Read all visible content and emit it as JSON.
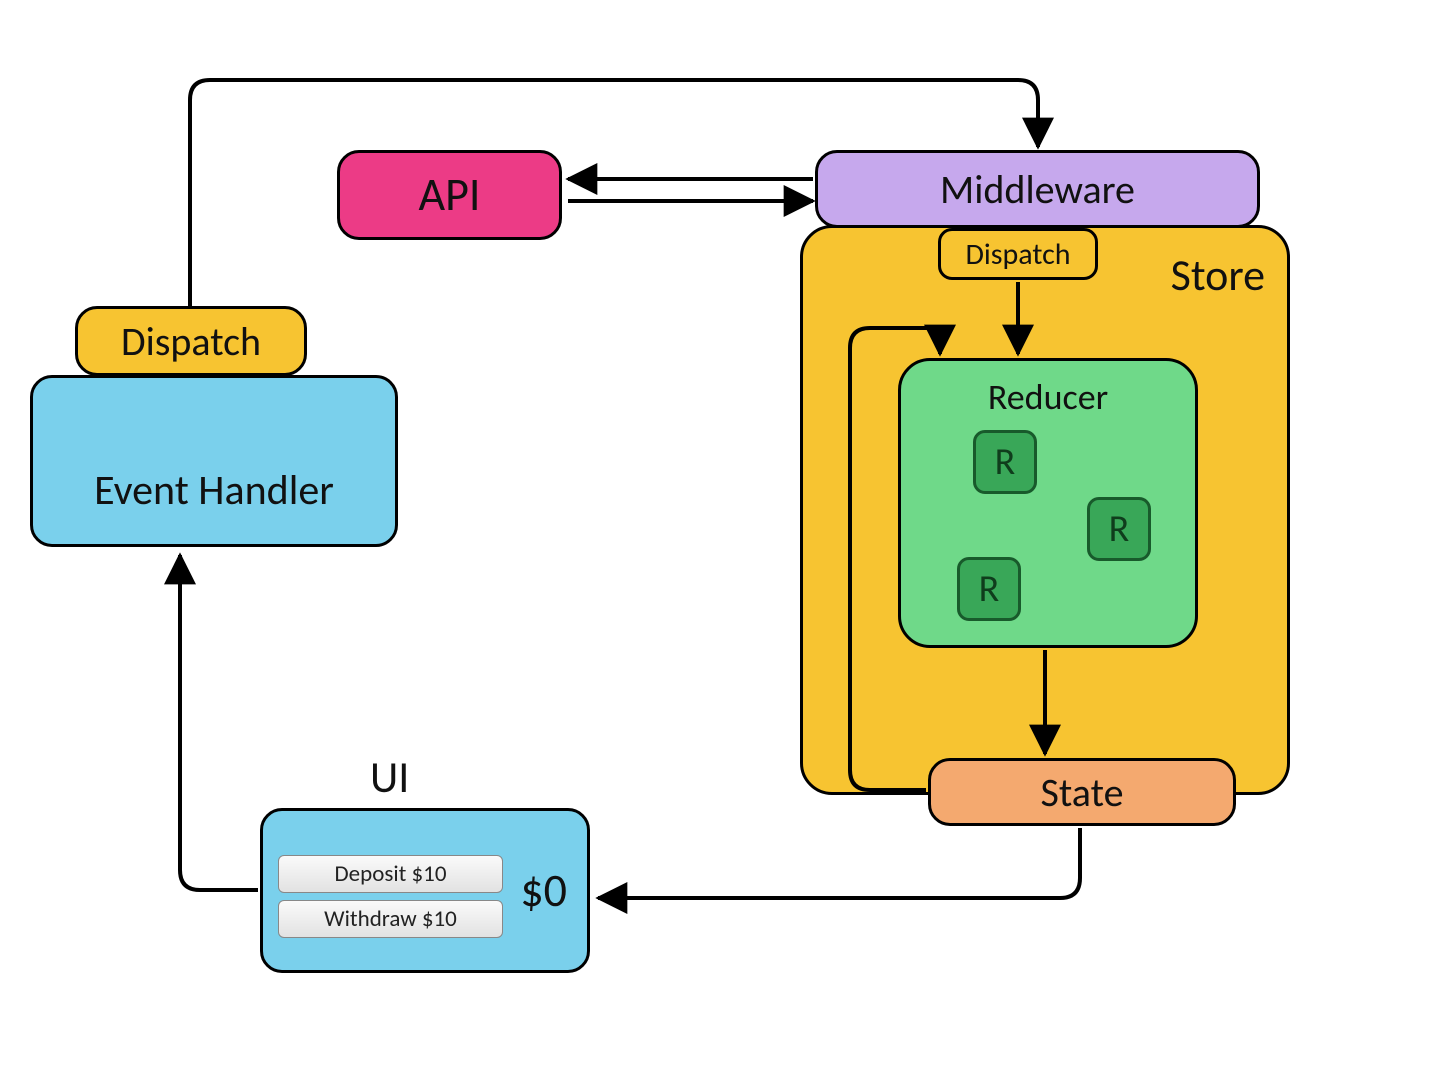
{
  "eventHandler": {
    "label": "Event Handler",
    "dispatchLabel": "Dispatch"
  },
  "api": {
    "label": "API"
  },
  "middleware": {
    "label": "Middleware"
  },
  "store": {
    "label": "Store",
    "dispatchLabel": "Dispatch",
    "reducer": {
      "label": "Reducer",
      "sub": [
        "R",
        "R",
        "R"
      ]
    },
    "stateLabel": "State"
  },
  "ui": {
    "heading": "UI",
    "balance": "$0",
    "buttons": {
      "deposit": "Deposit $10",
      "withdraw": "Withdraw $10"
    }
  }
}
